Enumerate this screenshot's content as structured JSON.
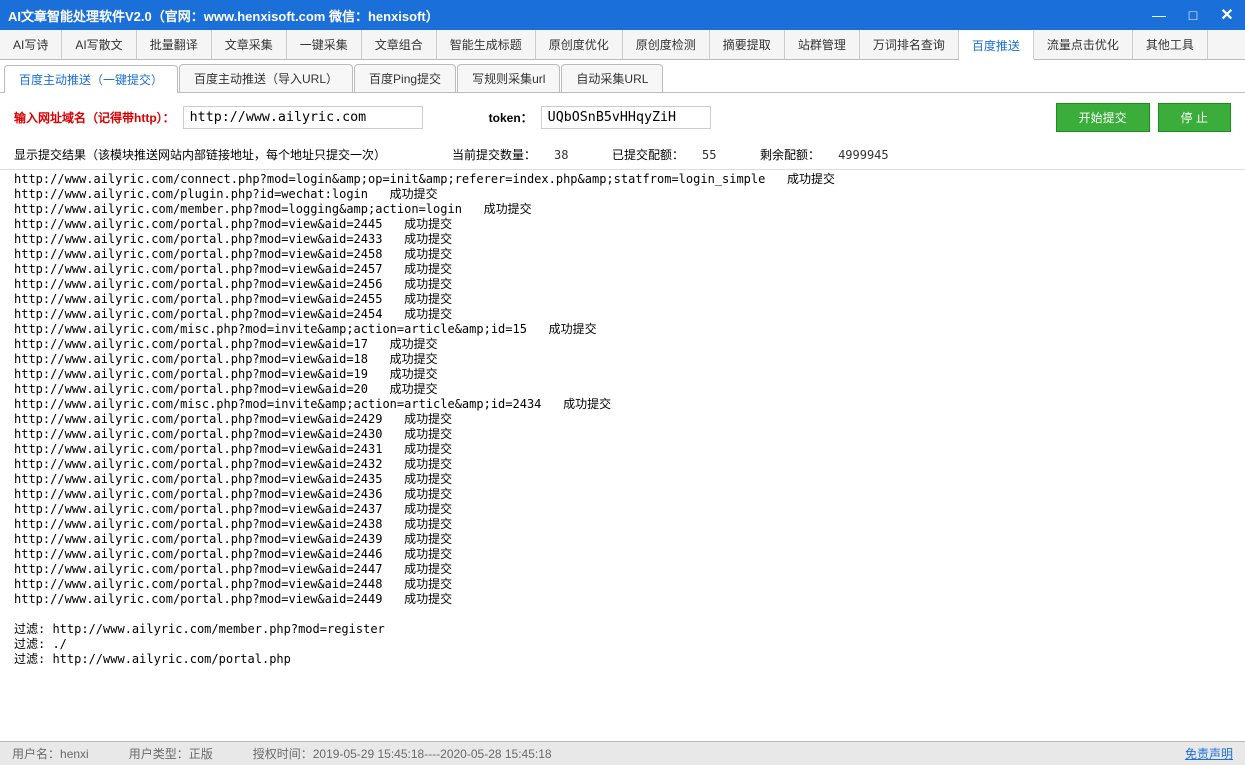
{
  "window": {
    "title": "AI文章智能处理软件V2.0（官网：www.henxisoft.com  微信：henxisoft）"
  },
  "main_tabs": [
    "AI写诗",
    "AI写散文",
    "批量翻译",
    "文章采集",
    "一键采集",
    "文章组合",
    "智能生成标题",
    "原创度优化",
    "原创度检测",
    "摘要提取",
    "站群管理",
    "万词排名查询",
    "百度推送",
    "流量点击优化",
    "其他工具"
  ],
  "main_tab_active": 12,
  "sub_tabs": [
    "百度主动推送（一键提交）",
    "百度主动推送（导入URL）",
    "百度Ping提交",
    "写规则采集url",
    "自动采集URL"
  ],
  "sub_tab_active": 0,
  "form": {
    "url_label": "输入网址域名（记得带http）：",
    "url_value": "http://www.ailyric.com",
    "token_label": "token：",
    "token_value": "UQbOSnB5vHHqyZiH",
    "start_btn": "开始提交",
    "stop_btn": "停 止"
  },
  "stats": {
    "result_header": "显示提交结果（该模块推送网站内部链接地址，每个地址只提交一次）",
    "current_label": "当前提交数量：",
    "current_value": "38",
    "submitted_label": "已提交配额：",
    "submitted_value": "55",
    "remain_label": "剩余配额：",
    "remain_value": "4999945"
  },
  "results_lines": [
    "http://www.ailyric.com/connect.php?mod=login&amp;op=init&amp;referer=index.php&amp;statfrom=login_simple   成功提交",
    "http://www.ailyric.com/plugin.php?id=wechat:login   成功提交",
    "http://www.ailyric.com/member.php?mod=logging&amp;action=login   成功提交",
    "http://www.ailyric.com/portal.php?mod=view&aid=2445   成功提交",
    "http://www.ailyric.com/portal.php?mod=view&aid=2433   成功提交",
    "http://www.ailyric.com/portal.php?mod=view&aid=2458   成功提交",
    "http://www.ailyric.com/portal.php?mod=view&aid=2457   成功提交",
    "http://www.ailyric.com/portal.php?mod=view&aid=2456   成功提交",
    "http://www.ailyric.com/portal.php?mod=view&aid=2455   成功提交",
    "http://www.ailyric.com/portal.php?mod=view&aid=2454   成功提交",
    "http://www.ailyric.com/misc.php?mod=invite&amp;action=article&amp;id=15   成功提交",
    "http://www.ailyric.com/portal.php?mod=view&aid=17   成功提交",
    "http://www.ailyric.com/portal.php?mod=view&aid=18   成功提交",
    "http://www.ailyric.com/portal.php?mod=view&aid=19   成功提交",
    "http://www.ailyric.com/portal.php?mod=view&aid=20   成功提交",
    "http://www.ailyric.com/misc.php?mod=invite&amp;action=article&amp;id=2434   成功提交",
    "http://www.ailyric.com/portal.php?mod=view&aid=2429   成功提交",
    "http://www.ailyric.com/portal.php?mod=view&aid=2430   成功提交",
    "http://www.ailyric.com/portal.php?mod=view&aid=2431   成功提交",
    "http://www.ailyric.com/portal.php?mod=view&aid=2432   成功提交",
    "http://www.ailyric.com/portal.php?mod=view&aid=2435   成功提交",
    "http://www.ailyric.com/portal.php?mod=view&aid=2436   成功提交",
    "http://www.ailyric.com/portal.php?mod=view&aid=2437   成功提交",
    "http://www.ailyric.com/portal.php?mod=view&aid=2438   成功提交",
    "http://www.ailyric.com/portal.php?mod=view&aid=2439   成功提交",
    "http://www.ailyric.com/portal.php?mod=view&aid=2446   成功提交",
    "http://www.ailyric.com/portal.php?mod=view&aid=2447   成功提交",
    "http://www.ailyric.com/portal.php?mod=view&aid=2448   成功提交",
    "http://www.ailyric.com/portal.php?mod=view&aid=2449   成功提交",
    "",
    "过滤: http://www.ailyric.com/member.php?mod=register",
    "过滤: ./",
    "过滤: http://www.ailyric.com/portal.php"
  ],
  "status": {
    "user_label": "用户名：",
    "user_value": "henxi",
    "type_label": "用户类型：",
    "type_value": "正版",
    "auth_label": "授权时间：",
    "auth_value": "2019-05-29 15:45:18----2020-05-28 15:45:18",
    "disclaimer": "免责声明"
  }
}
